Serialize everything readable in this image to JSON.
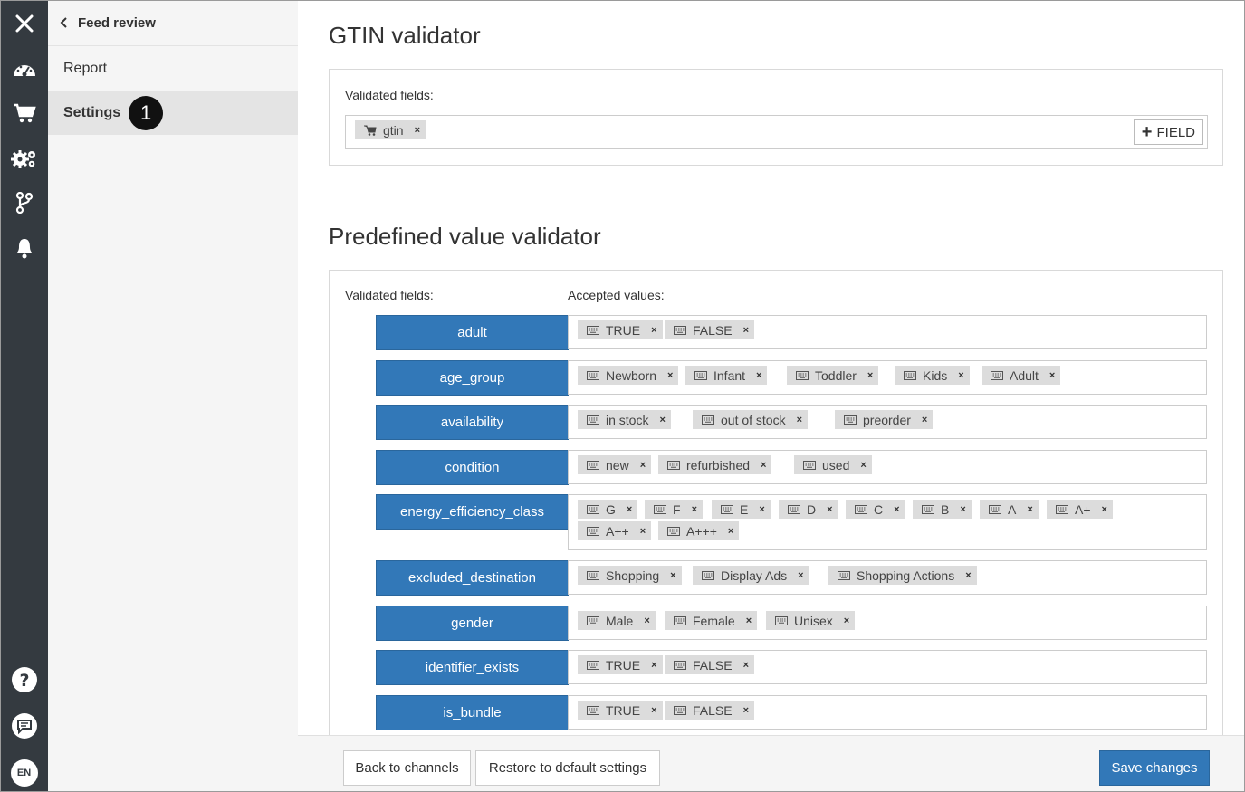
{
  "rail": {
    "icons": [
      "close-icon",
      "dashboard-icon",
      "cart-icon",
      "gears-icon",
      "branch-icon",
      "bell-icon"
    ],
    "bottom_icons": [
      "help-icon",
      "chat-icon"
    ],
    "language": "EN"
  },
  "sidenav": {
    "back_label": "Feed review",
    "items": [
      {
        "label": "Report"
      },
      {
        "label": "Settings"
      }
    ],
    "callout": "1"
  },
  "gtin": {
    "title": "GTIN validator",
    "validated_label": "Validated fields:",
    "tags": [
      {
        "label": "gtin",
        "icon": "cart-icon"
      }
    ],
    "add_field_label": "FIELD"
  },
  "predefined": {
    "title": "Predefined value validator",
    "validated_label": "Validated fields:",
    "accepted_label": "Accepted values:",
    "rows": [
      {
        "field": "adult",
        "values": [
          [
            "TRUE",
            "FALSE"
          ]
        ]
      },
      {
        "field": "age_group",
        "values": [
          [
            "Newborn",
            "Infant",
            "Toddler",
            "Kids",
            "Adult"
          ]
        ]
      },
      {
        "field": "availability",
        "values": [
          [
            "in stock",
            "out of stock",
            "preorder"
          ]
        ]
      },
      {
        "field": "condition",
        "values": [
          [
            "new",
            "refurbished",
            "used"
          ]
        ]
      },
      {
        "field": "energy_efficiency_class",
        "values": [
          [
            "G",
            "F",
            "E",
            "D",
            "C",
            "B",
            "A",
            "A+"
          ],
          [
            "A++",
            "A+++"
          ]
        ]
      },
      {
        "field": "excluded_destination",
        "values": [
          [
            "Shopping",
            "Display Ads",
            "Shopping Actions"
          ]
        ]
      },
      {
        "field": "gender",
        "values": [
          [
            "Male",
            "Female",
            "Unisex"
          ]
        ]
      },
      {
        "field": "identifier_exists",
        "values": [
          [
            "TRUE",
            "FALSE"
          ]
        ]
      },
      {
        "field": "is_bundle",
        "values": [
          [
            "TRUE",
            "FALSE"
          ]
        ]
      }
    ]
  },
  "footer": {
    "back_label": "Back to channels",
    "restore_label": "Restore to default settings",
    "save_label": "Save changes"
  },
  "colors": {
    "rail_bg": "#343a40",
    "primary": "#3278b8",
    "tag_bg": "#dcdcdc"
  }
}
